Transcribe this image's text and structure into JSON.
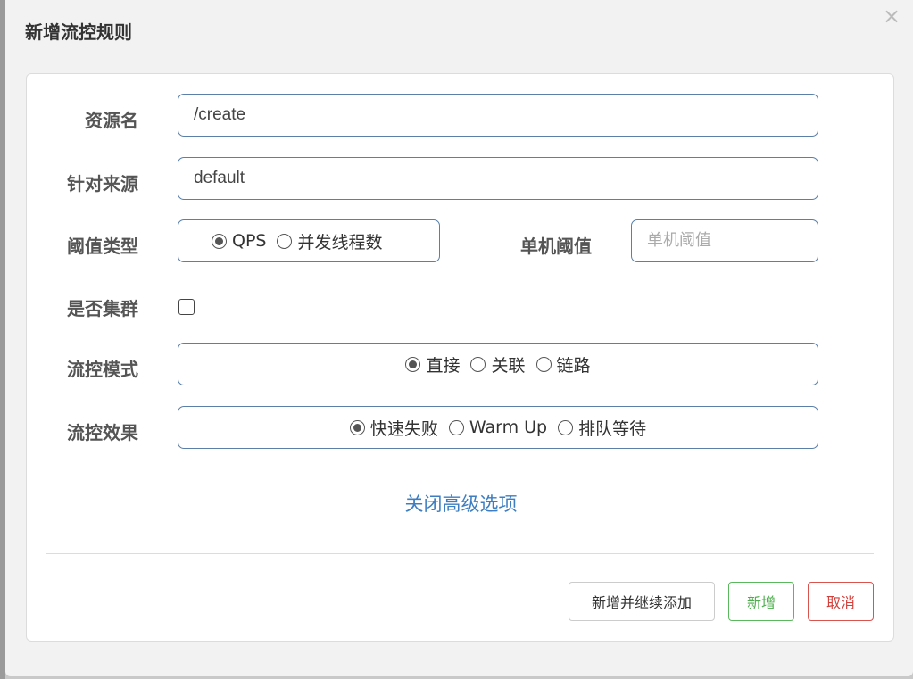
{
  "modal": {
    "title": "新增流控规则",
    "close": "×"
  },
  "form": {
    "resource": {
      "label": "资源名",
      "value": "/create"
    },
    "origin": {
      "label": "针对来源",
      "value": "default"
    },
    "threshold_type": {
      "label": "阈值类型",
      "options": [
        {
          "label": "QPS",
          "checked": true
        },
        {
          "label": "并发线程数",
          "checked": false
        }
      ]
    },
    "single_threshold": {
      "label": "单机阈值",
      "placeholder": "单机阈值",
      "value": ""
    },
    "cluster": {
      "label": "是否集群",
      "checked": false
    },
    "control_mode": {
      "label": "流控模式",
      "options": [
        {
          "label": "直接",
          "checked": true
        },
        {
          "label": "关联",
          "checked": false
        },
        {
          "label": "链路",
          "checked": false
        }
      ]
    },
    "control_effect": {
      "label": "流控效果",
      "options": [
        {
          "label": "快速失败",
          "checked": true
        },
        {
          "label": "Warm Up",
          "checked": false
        },
        {
          "label": "排队等待",
          "checked": false
        }
      ]
    },
    "advanced_toggle": "关闭高级选项"
  },
  "footer": {
    "add_continue": "新增并继续添加",
    "add": "新增",
    "cancel": "取消"
  },
  "colors": {
    "input_border": "#5a7fa8",
    "link": "#3d7ec2",
    "success": "#5cb85c",
    "danger": "#d9534f"
  }
}
